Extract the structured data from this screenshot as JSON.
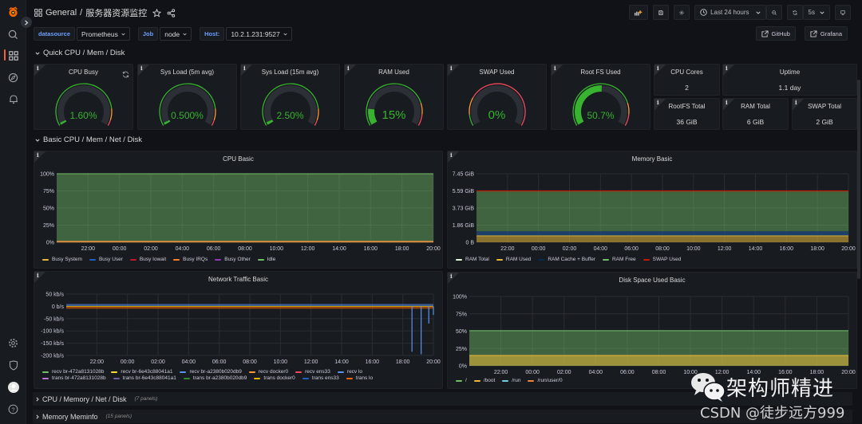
{
  "sidebar": {
    "top_icons": [
      "grafana-logo-icon",
      "search-icon",
      "dashboards-icon",
      "explore-icon",
      "alerting-icon"
    ],
    "bottom_icons": [
      "configuration-icon",
      "server-admin-icon",
      "user-avatar",
      "help-icon"
    ],
    "active": "dashboards-icon"
  },
  "header": {
    "folder": "General",
    "separator": "/",
    "title": "服务器资源监控",
    "time_range": "Last 24 hours",
    "refresh_interval": "5s"
  },
  "variables": [
    {
      "label": "datasource",
      "value": "Prometheus"
    },
    {
      "label": "Job",
      "value": "node"
    },
    {
      "label": "Host:",
      "value": "10.2.1.231:9527"
    }
  ],
  "links": [
    {
      "label": "GitHub"
    },
    {
      "label": "Grafana"
    }
  ],
  "rows": {
    "quick": "Quick CPU / Mem / Disk",
    "basic": "Basic CPU / Mem / Net / Disk",
    "collapsed": [
      {
        "title": "CPU / Memory / Net / Disk",
        "count": "(7 panels)"
      },
      {
        "title": "Memory Meminfo",
        "count": "(15 panels)"
      }
    ]
  },
  "gauges": [
    {
      "title": "CPU Busy",
      "value_text": "1.60%",
      "fraction": 0.016,
      "thresholds": [
        0.85,
        0.95
      ],
      "big": false
    },
    {
      "title": "Sys Load (5m avg)",
      "value_text": "0.500%",
      "fraction": 0.005,
      "thresholds": [
        0.85,
        0.95
      ],
      "big": false
    },
    {
      "title": "Sys Load (15m avg)",
      "value_text": "2.50%",
      "fraction": 0.025,
      "thresholds": [
        0.85,
        0.95
      ],
      "big": false
    },
    {
      "title": "RAM Used",
      "value_text": "15%",
      "fraction": 0.15,
      "thresholds": [
        0.8,
        0.9
      ],
      "big": true
    },
    {
      "title": "SWAP Used",
      "value_text": "0%",
      "fraction": 0.0,
      "thresholds": [
        0.1,
        0.25
      ],
      "big": true
    },
    {
      "title": "Root FS Used",
      "value_text": "50.7%",
      "fraction": 0.507,
      "thresholds": [
        0.8,
        0.9
      ],
      "big": false
    }
  ],
  "stats": {
    "cpu_cores": {
      "title": "CPU Cores",
      "value": "2"
    },
    "uptime": {
      "title": "Uptime",
      "value": "1.1 day"
    },
    "rootfs_total": {
      "title": "RootFS Total",
      "value": "36 GiB"
    },
    "ram_total": {
      "title": "RAM Total",
      "value": "6 GiB"
    },
    "swap_total": {
      "title": "SWAP Total",
      "value": "2 GiB"
    }
  },
  "colors": {
    "gauge_green": "#37b32f",
    "gauge_orange": "#ff9830",
    "gauge_red": "#f2495c",
    "gauge_track": "#2c2f35"
  },
  "chart_data": [
    {
      "type": "area",
      "title": "CPU Basic",
      "x_ticks": [
        "22:00",
        "00:00",
        "02:00",
        "04:00",
        "06:00",
        "08:00",
        "10:00",
        "12:00",
        "14:00",
        "16:00",
        "18:00",
        "20:00"
      ],
      "y_ticks": [
        "100%",
        "75%",
        "50%",
        "25%",
        "0%"
      ],
      "ylim": [
        0,
        100
      ],
      "stacked": true,
      "series": [
        {
          "name": "Busy System",
          "color": "#eab839",
          "value": 0.5
        },
        {
          "name": "Busy User",
          "color": "#1f60c4",
          "value": 0.8
        },
        {
          "name": "Busy Iowait",
          "color": "#c4162a",
          "value": 0.1
        },
        {
          "name": "Busy IRQs",
          "color": "#ff7f27",
          "value": 0.1
        },
        {
          "name": "Busy Other",
          "color": "#8f3bb8",
          "value": 0.0
        },
        {
          "name": "Idle",
          "color": "#73bf69",
          "value": 98.5
        }
      ]
    },
    {
      "type": "area",
      "title": "Memory Basic",
      "x_ticks": [
        "22:00",
        "00:00",
        "02:00",
        "04:00",
        "06:00",
        "08:00",
        "10:00",
        "12:00",
        "14:00",
        "16:00",
        "18:00",
        "20:00"
      ],
      "y_ticks": [
        "7.45 GiB",
        "5.59 GiB",
        "3.73 GiB",
        "1.86 GiB",
        "0 B"
      ],
      "ylim": [
        0,
        7.45
      ],
      "series": [
        {
          "name": "RAM Total",
          "color": "#e0f9d7",
          "value": 5.59
        },
        {
          "name": "RAM Used",
          "color": "#eab839",
          "value": 0.7
        },
        {
          "name": "RAM Cache + Buffer",
          "color": "#052b51",
          "value": 0.5
        },
        {
          "name": "RAM Free",
          "color": "#73bf69",
          "value": 4.39
        },
        {
          "name": "SWAP Used",
          "color": "#bf1b00",
          "value": 0.0
        }
      ]
    },
    {
      "type": "line",
      "title": "Network Traffic Basic",
      "x_ticks": [
        "22:00",
        "00:00",
        "02:00",
        "04:00",
        "06:00",
        "08:00",
        "10:00",
        "12:00",
        "14:00",
        "16:00",
        "18:00",
        "20:00"
      ],
      "y_ticks": [
        "50 kb/s",
        "0 b/s",
        "-50 kb/s",
        "-100 kb/s",
        "-150 kb/s",
        "-200 kb/s"
      ],
      "ylim": [
        -200,
        50
      ],
      "spikes": [
        {
          "x_hour": 18.6,
          "value": -185
        },
        {
          "x_hour": 19.2,
          "value": -195
        },
        {
          "x_hour": 19.7,
          "value": -70
        },
        {
          "x_hour": 20.0,
          "value": -35
        }
      ],
      "series": [
        {
          "name": "recv br-472a8131028b",
          "color": "#73bf69"
        },
        {
          "name": "recv br-6e43c88041a1",
          "color": "#fade2a"
        },
        {
          "name": "recv br-a2380b020db9",
          "color": "#5794f2"
        },
        {
          "name": "recv docker0",
          "color": "#ff9830"
        },
        {
          "name": "recv ens33",
          "color": "#f2495c"
        },
        {
          "name": "recv lo",
          "color": "#5794f2"
        },
        {
          "name": "trans br-472a8131028b",
          "color": "#b877d9"
        },
        {
          "name": "trans br-6e43c88041a1",
          "color": "#705da0"
        },
        {
          "name": "trans br-a2380b020db9",
          "color": "#37872d"
        },
        {
          "name": "trans docker0",
          "color": "#e0b400"
        },
        {
          "name": "trans ens33",
          "color": "#1f60c4"
        },
        {
          "name": "trans lo",
          "color": "#fa6400"
        }
      ]
    },
    {
      "type": "area",
      "title": "Disk Space Used Basic",
      "x_ticks": [
        "22:00",
        "00:00",
        "02:00",
        "04:00",
        "06:00",
        "08:00",
        "10:00",
        "12:00",
        "14:00",
        "16:00",
        "18:00",
        "20:00"
      ],
      "y_ticks": [
        "100%",
        "75%",
        "50%",
        "25%",
        "0%"
      ],
      "ylim": [
        0,
        100
      ],
      "series": [
        {
          "name": "/",
          "color": "#73bf69",
          "value": 50.7
        },
        {
          "name": "/boot",
          "color": "#eab839",
          "value": 15
        },
        {
          "name": "/run",
          "color": "#6ed0e0",
          "value": 0.5
        },
        {
          "name": "/run/user/0",
          "color": "#ef843c",
          "value": 0
        }
      ]
    }
  ],
  "watermark": {
    "line1": "架构师精进",
    "line2": "CSDN @徒步远方999"
  }
}
